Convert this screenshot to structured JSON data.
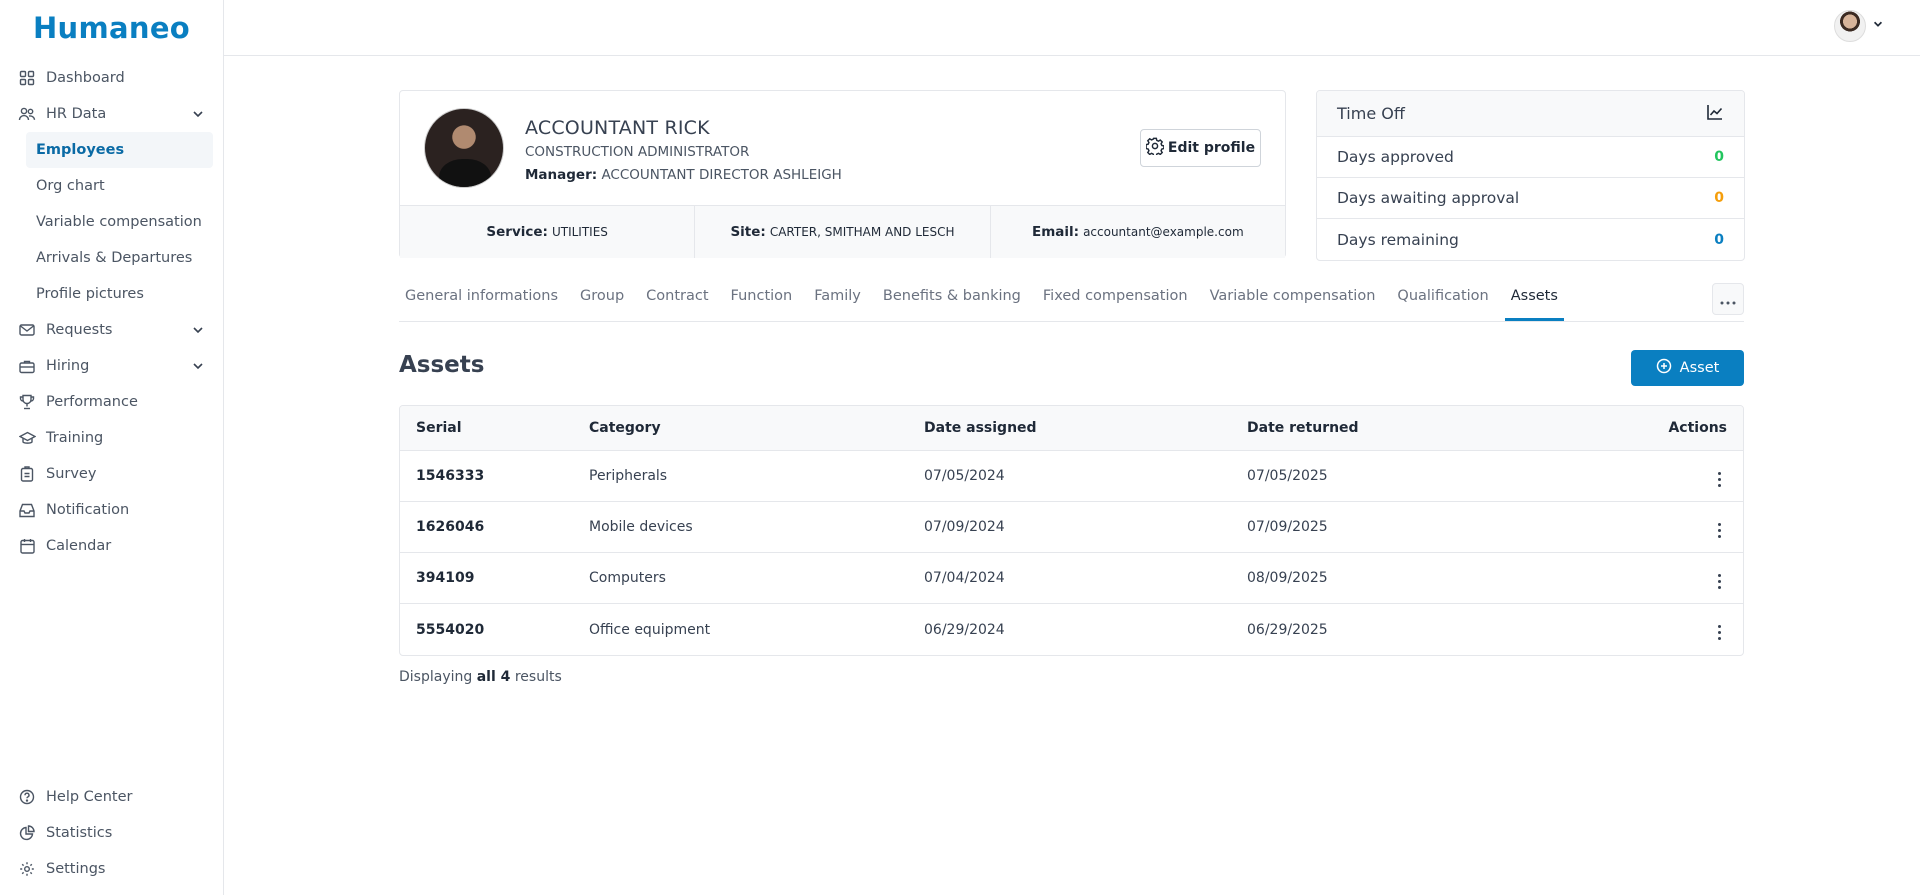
{
  "app": {
    "logo": "Humaneo"
  },
  "sidebar": {
    "items": [
      {
        "label": "Dashboard",
        "icon": "grid-icon"
      },
      {
        "label": "HR Data",
        "icon": "people-icon",
        "expanded": true,
        "children": [
          "Employees",
          "Org chart",
          "Variable compensation",
          "Arrivals & Departures",
          "Profile pictures"
        ]
      },
      {
        "label": "Requests",
        "icon": "envelope-icon"
      },
      {
        "label": "Hiring",
        "icon": "briefcase-icon"
      },
      {
        "label": "Performance",
        "icon": "trophy-icon"
      },
      {
        "label": "Training",
        "icon": "graduation-cap-icon"
      },
      {
        "label": "Survey",
        "icon": "clipboard-icon"
      },
      {
        "label": "Notification",
        "icon": "inbox-icon"
      },
      {
        "label": "Calendar",
        "icon": "calendar-icon"
      }
    ],
    "active_child": "Employees",
    "bottom": [
      {
        "label": "Help Center",
        "icon": "help-circle-icon"
      },
      {
        "label": "Statistics",
        "icon": "pie-chart-icon"
      },
      {
        "label": "Settings",
        "icon": "gear-icon"
      }
    ]
  },
  "profile": {
    "name": "ACCOUNTANT RICK",
    "job_title": "CONSTRUCTION ADMINISTRATOR",
    "manager_label": "Manager:",
    "manager": "ACCOUNTANT DIRECTOR ASHLEIGH",
    "edit_label": "Edit profile",
    "service_label": "Service:",
    "service": "UTILITIES",
    "site_label": "Site:",
    "site": "CARTER, SMITHAM AND LESCH",
    "email_label": "Email:",
    "email": "accountant@example.com"
  },
  "time_off": {
    "title": "Time Off",
    "rows": [
      {
        "label": "Days approved",
        "value": "0",
        "color": "#22c55e"
      },
      {
        "label": "Days awaiting approval",
        "value": "0",
        "color": "#f59e0b"
      },
      {
        "label": "Days remaining",
        "value": "0",
        "color": "#0a7fc1"
      }
    ]
  },
  "tabs": [
    "General informations",
    "Group",
    "Contract",
    "Function",
    "Family",
    "Benefits & banking",
    "Fixed compensation",
    "Variable compensation",
    "Qualification",
    "Assets"
  ],
  "active_tab": "Assets",
  "assets": {
    "title": "Assets",
    "add_label": "Asset",
    "columns": [
      "Serial",
      "Category",
      "Date assigned",
      "Date returned",
      "Actions"
    ],
    "rows": [
      {
        "serial": "1546333",
        "category": "Peripherals",
        "assigned": "07/05/2024",
        "returned": "07/05/2025"
      },
      {
        "serial": "1626046",
        "category": "Mobile devices",
        "assigned": "07/09/2024",
        "returned": "07/09/2025"
      },
      {
        "serial": "394109",
        "category": "Computers",
        "assigned": "07/04/2024",
        "returned": "08/09/2025"
      },
      {
        "serial": "5554020",
        "category": "Office equipment",
        "assigned": "06/29/2024",
        "returned": "06/29/2025"
      }
    ],
    "results_prefix": "Displaying",
    "results_bold": "all 4",
    "results_suffix": "results"
  },
  "colors": {
    "accent": "#0a7fc1"
  }
}
